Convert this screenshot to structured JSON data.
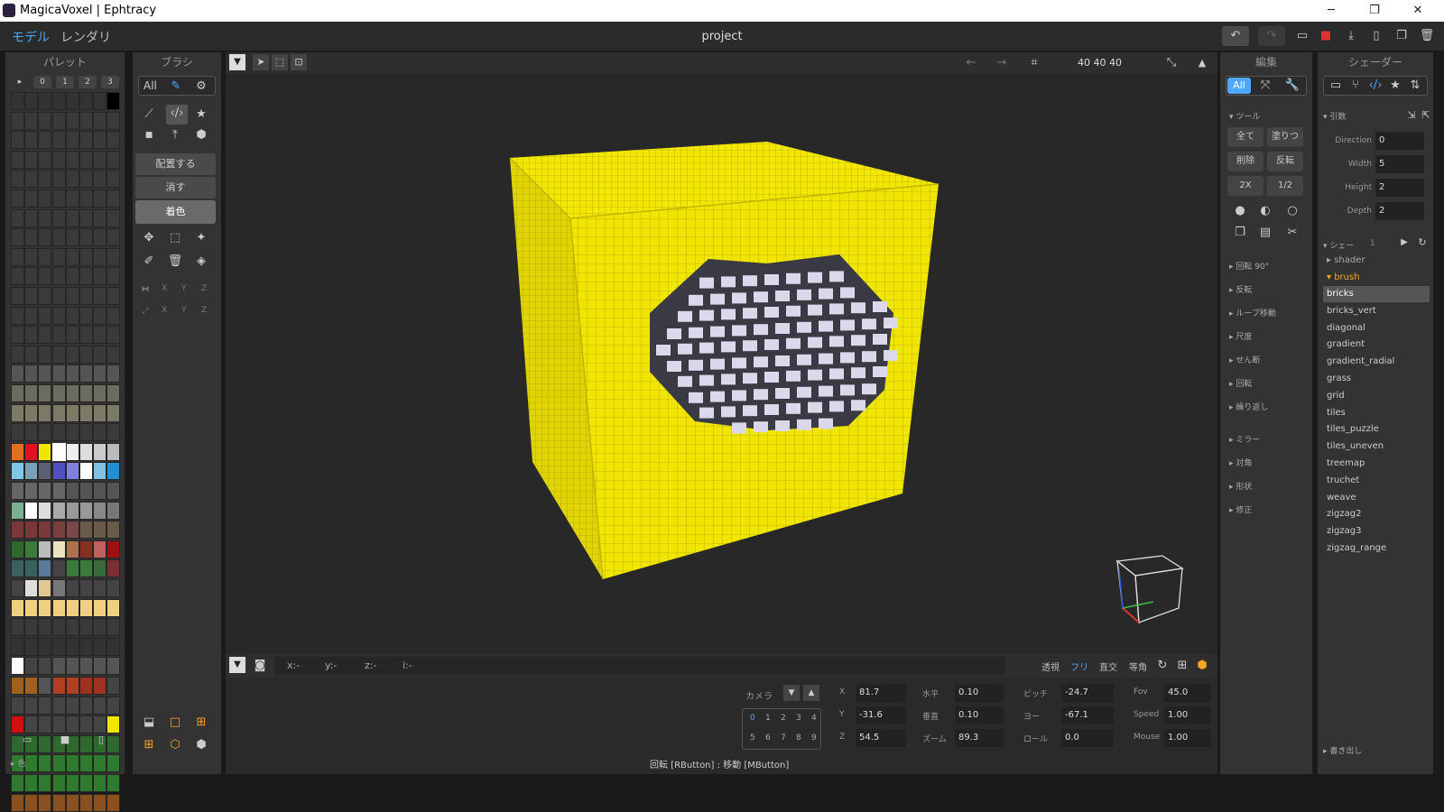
{
  "window": {
    "title": "MagicaVoxel | Ephtracy",
    "minimize": "─",
    "maximize": "❐",
    "close": "✕"
  },
  "menu": {
    "model": "モデル",
    "render": "レンダリ",
    "project": "project"
  },
  "palette": {
    "title": "パレット",
    "tabs": [
      "▸",
      "0",
      "1",
      "2",
      "3"
    ],
    "footer": "▸ 色"
  },
  "brush": {
    "title": "ブラシ",
    "filter_all": "All",
    "modes": [
      "配置する",
      "消す",
      "着色"
    ],
    "axes1": [
      "X",
      "Y",
      "Z"
    ],
    "axes2": [
      "X",
      "Y",
      "Z"
    ]
  },
  "viewport": {
    "size": "40  40  40"
  },
  "coords": {
    "x": "x:-",
    "y": "y:-",
    "z": "z:-",
    "i": "i:-"
  },
  "view_modes": [
    "透視",
    "フリ",
    "直交",
    "等角"
  ],
  "camera": {
    "label": "カメラ",
    "slots_row1": [
      "0",
      "1",
      "2",
      "3",
      "4"
    ],
    "slots_row2": [
      "5",
      "6",
      "7",
      "8",
      "9"
    ],
    "x_label": "X",
    "x": "81.7",
    "y_label": "Y",
    "y": "-31.6",
    "z_label": "Z",
    "z": "54.5",
    "h_label": "水平",
    "h": "0.10",
    "v_label": "垂直",
    "v": "0.10",
    "zoom_label": "ズーム",
    "zoom": "89.3",
    "pitch_label": "ピッチ",
    "pitch": "-24.7",
    "yaw_label": "ヨー",
    "yaw": "-67.1",
    "roll_label": "ロール",
    "roll": "0.0",
    "fov_label": "Fov",
    "fov": "45.0",
    "speed_label": "Speed",
    "speed": "1.00",
    "mouse_label": "Mouse",
    "mouse": "1.00"
  },
  "status": "回転 [RButton] : 移動 [MButton]",
  "edit": {
    "title": "編集",
    "all": "All",
    "tool_section": "▾ ツール",
    "buttons": [
      "全て",
      "塗りつ",
      "削除",
      "反転",
      "2X",
      "1/2"
    ],
    "sections": [
      "▸ 回転 90°",
      "▸ 反転",
      "▸ ループ移動",
      "▸ 尺度",
      "▸ せん断",
      "▸ 回転",
      "▸ 繰り返し",
      "▸ ミラー",
      "▸ 対角",
      "▸ 形状",
      "▸ 修正"
    ]
  },
  "shader": {
    "title": "シェーダー",
    "args_section": "▾ 引数",
    "args": [
      {
        "name": "Direction",
        "value": "0"
      },
      {
        "name": "Width",
        "value": "5"
      },
      {
        "name": "Height",
        "value": "2"
      },
      {
        "name": "Depth",
        "value": "2"
      }
    ],
    "list_section": "▾ シェー",
    "list_count": "1",
    "folders": [
      {
        "name": "▸ shader"
      },
      {
        "name": "▾ brush"
      }
    ],
    "items": [
      "bricks",
      "bricks_vert",
      "diagonal",
      "gradient",
      "gradient_radial",
      "grass",
      "grid",
      "tiles",
      "tiles_puzzle",
      "tiles_uneven",
      "treemap",
      "truchet",
      "weave",
      "zigzag2",
      "zigzag3",
      "zigzag_range"
    ],
    "selected": "bricks",
    "export": "▸ 書き出し"
  },
  "colors": {
    "accent": "#4fa8ff",
    "yellow": "#f0e600",
    "selected_orange": "#f5a623"
  }
}
